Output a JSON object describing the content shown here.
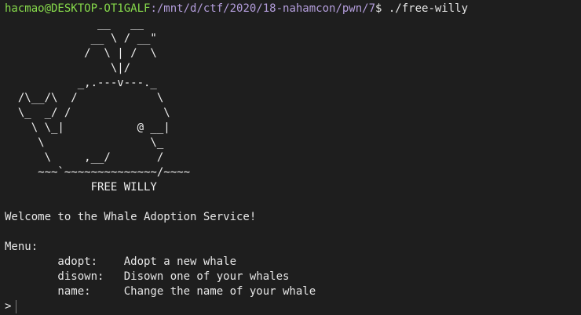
{
  "prompt": {
    "user_host": "hacmao@DESKTOP-OT1GALF",
    "path": ":/mnt/d/ctf/2020/18-nahamcon/pwn/7",
    "command": "$ ./free-willy"
  },
  "art_lines": [
    "              __   __",
    "             __ \\ / __\"",
    "            /  \\ | /  \\",
    "                \\|/",
    "           _,.---v---._",
    "  /\\__/\\  /            \\",
    "  \\_  _/ /              \\",
    "    \\ \\_|           @ __|",
    "     \\                \\_",
    "      \\     ,__/       /",
    "     ~~~`~~~~~~~~~~~~~~/~~~~",
    "             FREE WILLY"
  ],
  "welcome": "Welcome to the Whale Adoption Service!",
  "menu_title": "Menu:",
  "menu_items": [
    {
      "cmd": "        adopt:    ",
      "desc": "Adopt a new whale"
    },
    {
      "cmd": "        disown:   ",
      "desc": "Disown one of your whales"
    },
    {
      "cmd": "        name:     ",
      "desc": "Change the name of your whale"
    }
  ],
  "input_prompt": ">"
}
